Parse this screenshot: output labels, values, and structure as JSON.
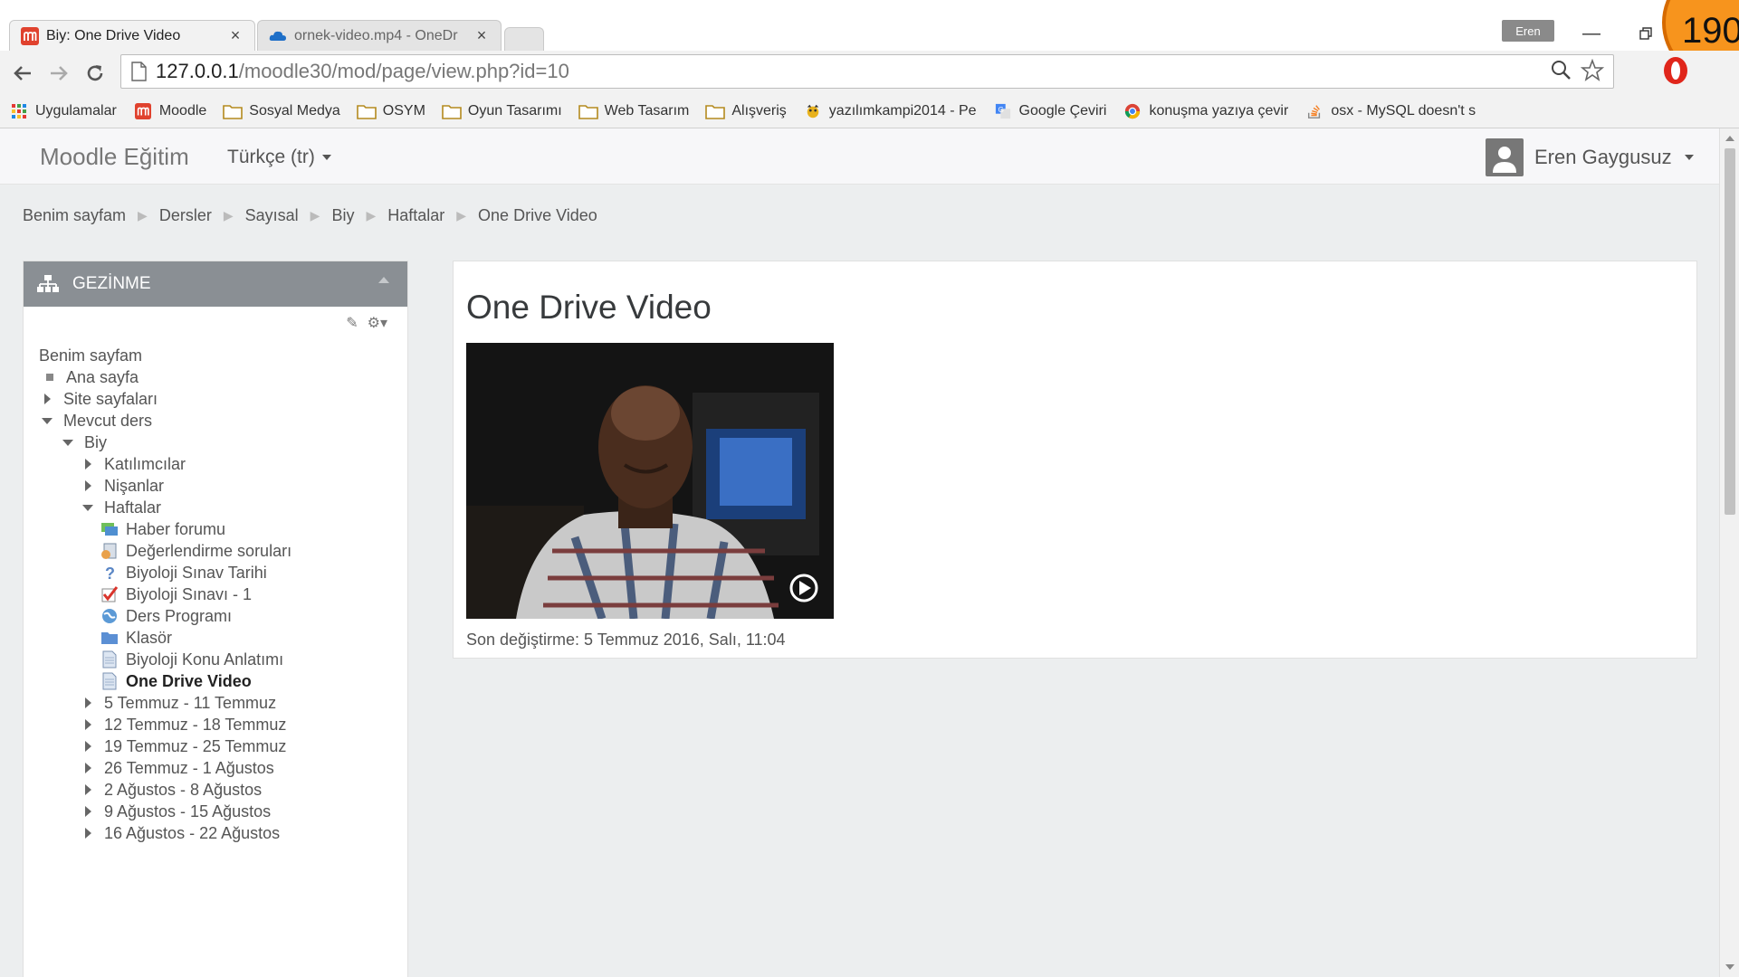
{
  "browser": {
    "tabs": [
      {
        "title": "Biy: One Drive Video",
        "close": "×",
        "active": true
      },
      {
        "title": "ornek-video.mp4 - OneDr",
        "close": "×",
        "active": false
      }
    ],
    "profile": "Eren",
    "badge": "190",
    "url_host": "127.0.0.1",
    "url_path": "/moodle30/mod/page/view.php?id=10",
    "bookmarks": [
      {
        "label": "Uygulamalar",
        "icon": "apps-grid-icon"
      },
      {
        "label": "Moodle",
        "icon": "moodle-icon"
      },
      {
        "label": "Sosyal Medya",
        "icon": "folder-icon"
      },
      {
        "label": "OSYM",
        "icon": "folder-icon"
      },
      {
        "label": "Oyun Tasarımı",
        "icon": "folder-icon"
      },
      {
        "label": "Web Tasarım",
        "icon": "folder-icon"
      },
      {
        "label": "Alışveriş",
        "icon": "folder-icon"
      },
      {
        "label": "yazılımkampi2014 - Pe",
        "icon": "site-icon"
      },
      {
        "label": "Google Çeviri",
        "icon": "translate-icon"
      },
      {
        "label": "konuşma yazıya çevir",
        "icon": "chrome-icon"
      },
      {
        "label": "osx - MySQL doesn't s",
        "icon": "stackoverflow-icon"
      }
    ]
  },
  "navbar": {
    "brand": "Moodle Eğitim",
    "language": "Türkçe (tr)",
    "user": "Eren Gaygusuz"
  },
  "breadcrumb": [
    "Benim sayfam",
    "Dersler",
    "Sayısal",
    "Biy",
    "Haftalar",
    "One Drive Video"
  ],
  "navigation": {
    "title": "GEZİNME",
    "items": [
      {
        "label": "Benim sayfam",
        "type": "plain"
      },
      {
        "label": "Ana sayfa",
        "type": "dot"
      },
      {
        "label": "Site sayfaları",
        "type": "collapsed"
      },
      {
        "label": "Mevcut ders",
        "type": "expanded"
      },
      {
        "label": "Biy",
        "type": "expanded"
      },
      {
        "label": "Katılımcılar",
        "type": "collapsed"
      },
      {
        "label": "Nişanlar",
        "type": "collapsed"
      },
      {
        "label": "Haftalar",
        "type": "expanded"
      },
      {
        "label": "Haber forumu",
        "type": "forum"
      },
      {
        "label": "Değerlendirme soruları",
        "type": "feedback"
      },
      {
        "label": "Biyoloji Sınav Tarihi",
        "type": "choice"
      },
      {
        "label": "Biyoloji Sınavı - 1",
        "type": "quiz"
      },
      {
        "label": "Ders Programı",
        "type": "url"
      },
      {
        "label": "Klasör",
        "type": "folder"
      },
      {
        "label": "Biyoloji Konu Anlatımı",
        "type": "page"
      },
      {
        "label": "One Drive Video",
        "type": "page",
        "current": true
      },
      {
        "label": "5 Temmuz - 11 Temmuz",
        "type": "collapsed"
      },
      {
        "label": "12 Temmuz - 18 Temmuz",
        "type": "collapsed"
      },
      {
        "label": "19 Temmuz - 25 Temmuz",
        "type": "collapsed"
      },
      {
        "label": "26 Temmuz - 1 Ağustos",
        "type": "collapsed"
      },
      {
        "label": "2 Ağustos - 8 Ağustos",
        "type": "collapsed"
      },
      {
        "label": "9 Ağustos - 15 Ağustos",
        "type": "collapsed"
      },
      {
        "label": "16 Ağustos - 22 Ağustos",
        "type": "collapsed"
      }
    ]
  },
  "content": {
    "title": "One Drive Video",
    "modified": "Son değiştirme: 5 Temmuz 2016, Salı, 11:04"
  }
}
